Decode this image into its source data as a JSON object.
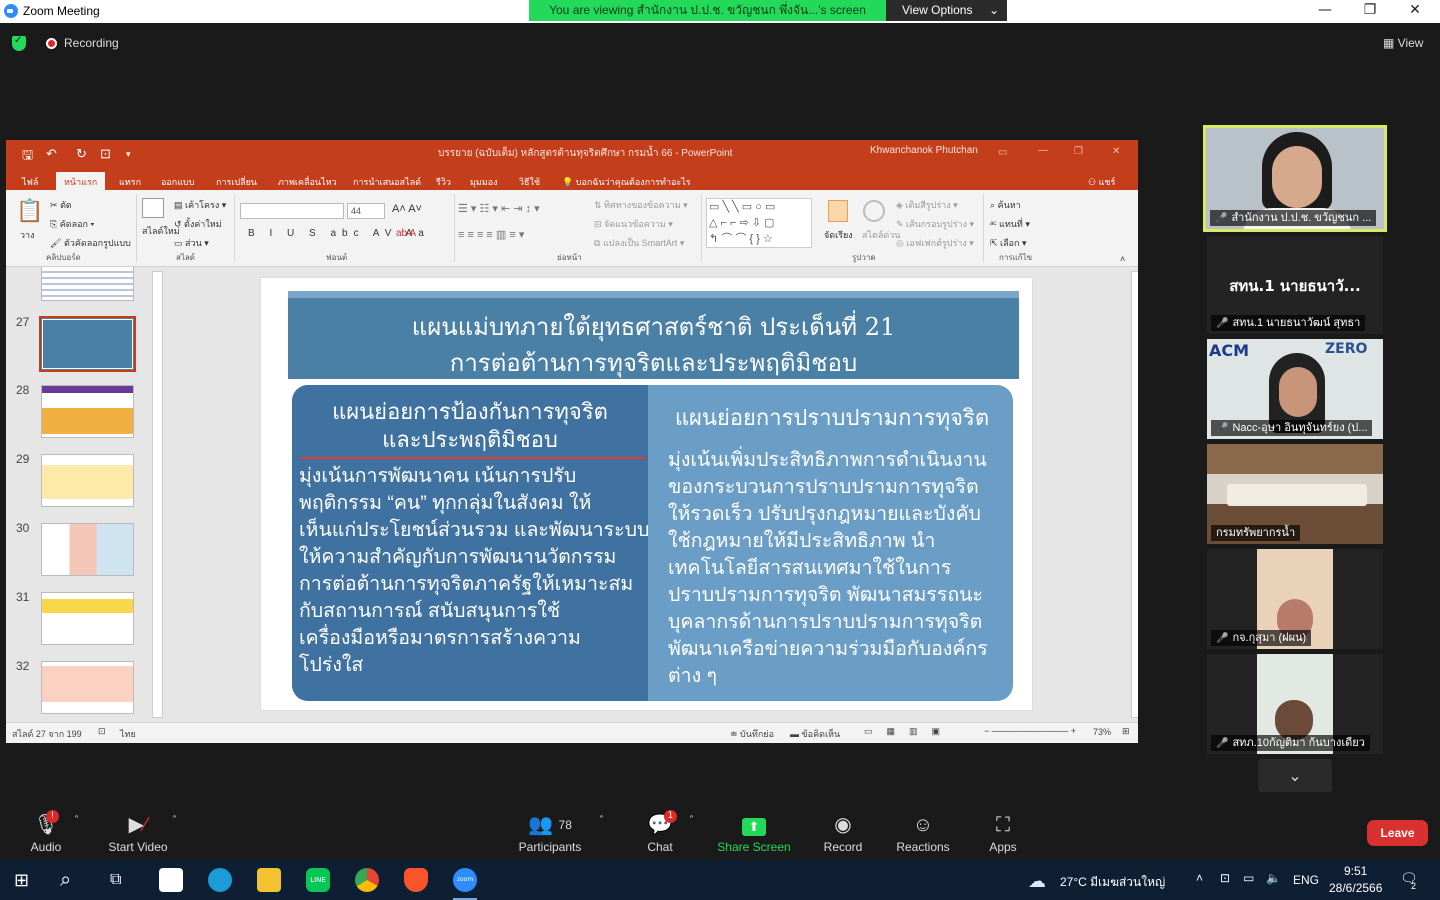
{
  "window": {
    "title": "Zoom Meeting"
  },
  "share_banner": {
    "text": "You are viewing สำนักงาน ป.ป.ช. ขวัญชนก พึ่งจัน...'s screen",
    "view_options": "View Options"
  },
  "meeting": {
    "recording": "Recording",
    "view": "View"
  },
  "ppt": {
    "doc_title": "บรรยาย (ฉบับเต็ม) หลักสูตรต้านทุจริตศึกษา กรมน้ำ 66  -  PowerPoint",
    "user": "Khwanchanok Phutchan",
    "tabs": [
      "ไฟล์",
      "หน้าแรก",
      "แทรก",
      "ออกแบบ",
      "การเปลี่ยน",
      "ภาพเคลื่อนไหว",
      "การนำเสนอสไลด์",
      "รีวิว",
      "มุมมอง",
      "วิธีใช้",
      "บอกฉันว่าคุณต้องการทำอะไร",
      "แชร์"
    ],
    "ribbon": {
      "paste": "วาง",
      "cut": "ตัด",
      "copy": "คัดลอก",
      "format_painter": "ตัวคัดลอกรูปแบบ",
      "clipboard": "คลิปบอร์ด",
      "new_slide": "สไลด์ใหม่",
      "layout": "เค้าโครง",
      "reset": "ตั้งค่าใหม่",
      "section": "ส่วน",
      "slides": "สไลด์",
      "font_size": "44",
      "font": "ฟอนต์",
      "paragraph": "ย่อหน้า",
      "text_direction": "ทิศทางของข้อความ",
      "align_text": "จัดแนวข้อความ",
      "smartart": "แปลงเป็น SmartArt",
      "arrange": "จัดเรียง",
      "quick_styles": "สไตล์ด่วน",
      "drawing": "รูปวาด",
      "shape_fill": "เติมสีรูปร่าง",
      "shape_outline": "เส้นกรอบรูปร่าง",
      "shape_effects": "เอฟเฟกต์รูปร่าง",
      "find": "ค้นหา",
      "replace": "แทนที่",
      "select": "เลือก",
      "editing": "การแก้ไข"
    },
    "thumbnails": [
      {
        "num": "27"
      },
      {
        "num": "28"
      },
      {
        "num": "29"
      },
      {
        "num": "30"
      },
      {
        "num": "31"
      },
      {
        "num": "32"
      }
    ],
    "slide": {
      "title1": "แผนแม่บทภายใต้ยุทธศาสตร์ชาติ ประเด็นที่ 21",
      "title2": "การต่อต้านการทุจริตและประพฤติมิชอบ",
      "left_head1": "แผนย่อยการป้องกันการทุจริต",
      "left_head2": "และประพฤติมิชอบ",
      "left_body": [
        "มุ่งเน้นการพัฒนาคน เน้นการปรับ",
        "พฤติกรรม “คน” ทุกกลุ่มในสังคม ให้",
        "เห็นแก่ประโยชน์ส่วนรวม และพัฒนาระบบ",
        "ให้ความสำคัญกับการพัฒนานวัตกรรม",
        "การต่อต้านการทุจริตภาครัฐให้เหมาะสม",
        "กับสถานการณ์ สนับสนุนการใช้",
        "เครื่องมือหรือมาตรการสร้างความ",
        "โปร่งใส"
      ],
      "right_head": "แผนย่อยการปราบปรามการทุจริต",
      "right_body": [
        "มุ่งเน้นเพิ่มประสิทธิภาพการดำเนินงาน",
        "ของกระบวนการปราบปรามการทุจริต",
        "ให้รวดเร็ว ปรับปรุงกฎหมายและบังคับ",
        "ใช้กฎหมายให้มีประสิทธิภาพ นำ",
        "เทคโนโลยีสารสนเทศมาใช้ในการ",
        "ปราบปรามการทุจริต พัฒนาสมรรถนะ",
        "บุคลากรด้านการปราบปรามการทุจริต",
        "พัฒนาเครือข่ายความร่วมมือกับองค์กร",
        "ต่าง ๆ"
      ]
    },
    "status": {
      "slide_of": "สไลด์ 27 จาก 199",
      "language": "ไทย",
      "notes": "บันทึกย่อ",
      "comments": "ข้อคิดเห็น",
      "zoom": "73%"
    }
  },
  "participants": [
    {
      "name": "สำนักงาน ป.ป.ช. ขวัญชนก ...",
      "muted": false
    },
    {
      "name": "สทน.1 นายธนาวัฒน์ สุทธา",
      "big": "สทน.1 นายธนาวั...",
      "muted": true
    },
    {
      "name": "Nacc-อุษา อินทุจันทร์ยง (ป...",
      "muted": true
    },
    {
      "name": "กรมทรัพยากรน้ำ",
      "muted": false
    },
    {
      "name": "กจ.กุสุมา (ฝผน)",
      "muted": true
    },
    {
      "name": "สทภ.10กัญติมา  ก้นบางเดียว",
      "muted": true
    }
  ],
  "toolbar": {
    "audio": "Audio",
    "video": "Start Video",
    "participants": "Participants",
    "participants_count": "78",
    "chat": "Chat",
    "chat_badge": "1",
    "audio_badge": "!",
    "share": "Share Screen",
    "record": "Record",
    "reactions": "Reactions",
    "apps": "Apps",
    "leave": "Leave"
  },
  "taskbar": {
    "weather": "27°C  มีเมฆส่วนใหญ่",
    "lang": "ENG",
    "time": "9:51",
    "date": "28/6/2566",
    "notif": "2"
  },
  "colors": {
    "ppt_red": "#c43e1c",
    "slide_blue": "#4a7fa6",
    "share_green": "#23d959",
    "leave_red": "#d93030"
  }
}
